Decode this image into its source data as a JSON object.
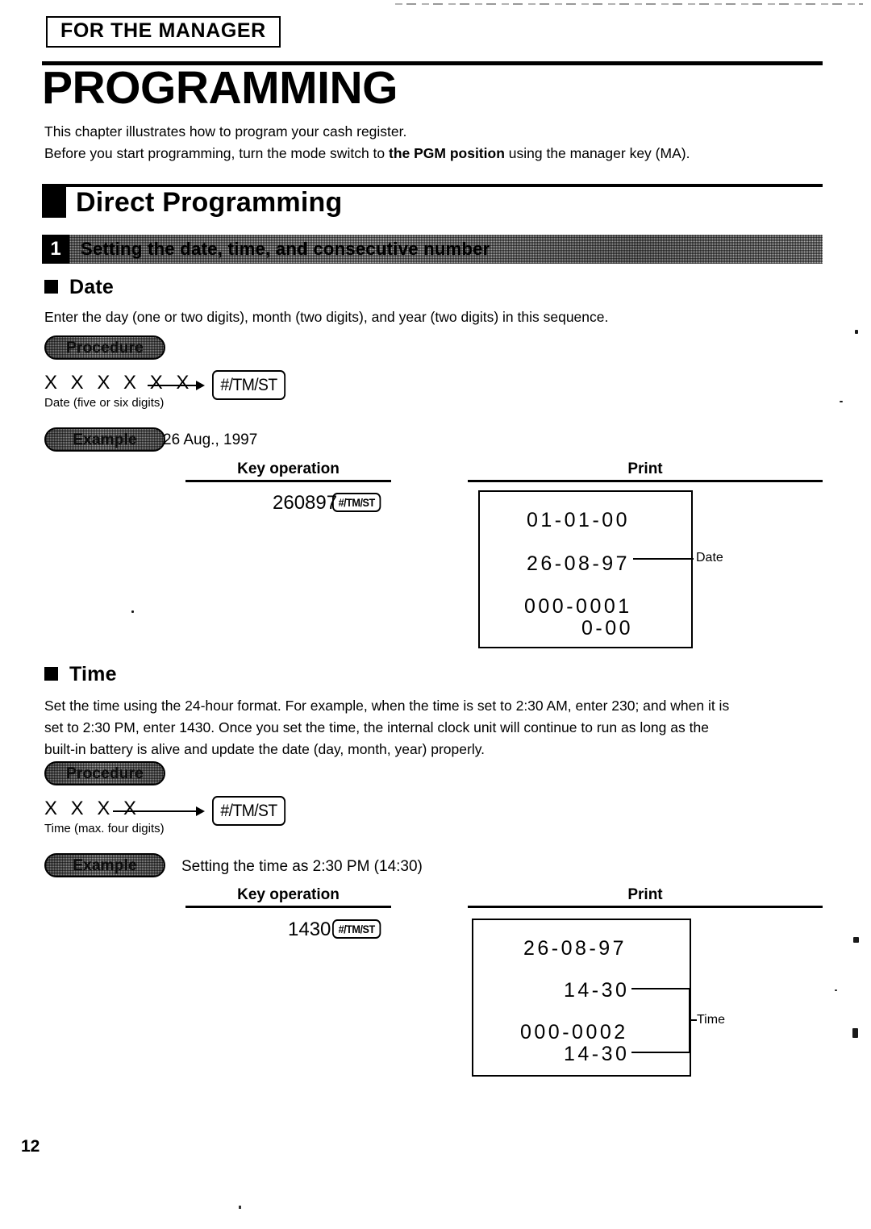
{
  "header": {
    "banner": "FOR THE MANAGER",
    "chapter_title": "PROGRAMMING",
    "intro_line1": "This chapter illustrates how to program your cash register.",
    "intro_line2_a": "Before you start programming, turn the mode switch to ",
    "intro_line2_bold": "the PGM position",
    "intro_line2_b": " using the manager key (MA)."
  },
  "section": {
    "h2_title": "Direct Programming",
    "number": "1",
    "bar_title": "Setting the date, time, and consecutive number"
  },
  "date_block": {
    "heading": "Date",
    "description": "Enter the day (one or two digits), month (two digits), and year (two digits) in this sequence.",
    "procedure_label": "Procedure",
    "sequence": "X X X X X X",
    "sequence_caption": "Date (five or six digits)",
    "key_glyph": "#/TM/ST",
    "example_label": "Example",
    "example_caption": "26 Aug., 1997",
    "col_key_operation": "Key operation",
    "col_print": "Print",
    "key_operation_value": "260897",
    "key_operation_key": "#/TM/ST",
    "receipt_lines": [
      "01-01-00",
      "26-08-97",
      "000-0001",
      "0-00"
    ],
    "annotation": "Date"
  },
  "time_block": {
    "heading": "Time",
    "description_line1": "Set the time using the 24-hour format.  For example, when the time is set to 2:30 AM, enter 230; and when it is",
    "description_line2": "set to 2:30 PM, enter 1430.  Once you set the time, the internal clock unit will continue to run as long as the",
    "description_line3": "built-in battery is alive and update the date (day, month, year) properly.",
    "procedure_label": "Procedure",
    "sequence": "X X X X",
    "sequence_caption": "Time (max. four digits)",
    "key_glyph": "#/TM/ST",
    "example_label": "Example",
    "example_caption": "Setting the time as 2:30 PM (14:30)",
    "col_key_operation": "Key operation",
    "col_print": "Print",
    "key_operation_value": "1430",
    "key_operation_key": "#/TM/ST",
    "receipt_lines": [
      "26-08-97",
      "14-30",
      "000-0002",
      "14-30"
    ],
    "annotation": "Time"
  },
  "footer": {
    "page_number": "12"
  }
}
